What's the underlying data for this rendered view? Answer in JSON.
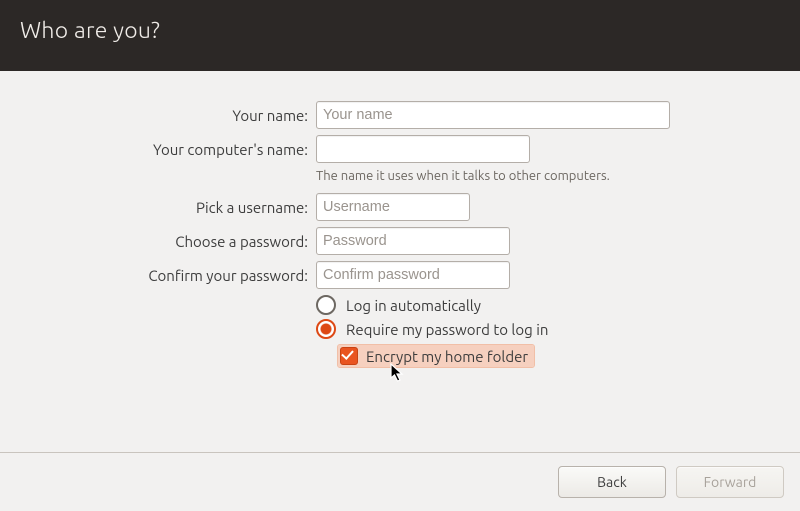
{
  "header": {
    "title": "Who are you?"
  },
  "form": {
    "name": {
      "label": "Your name:",
      "placeholder": "Your name",
      "value": ""
    },
    "computer": {
      "label": "Your computer's name:",
      "placeholder": "",
      "value": "",
      "hint": "The name it uses when it talks to other computers."
    },
    "username": {
      "label": "Pick a username:",
      "placeholder": "Username",
      "value": ""
    },
    "password": {
      "label": "Choose a password:",
      "placeholder": "Password",
      "value": ""
    },
    "confirm": {
      "label": "Confirm your password:",
      "placeholder": "Confirm password",
      "value": ""
    },
    "login_options": {
      "auto": {
        "label": "Log in automatically",
        "checked": false
      },
      "require": {
        "label": "Require my password to log in",
        "checked": true
      }
    },
    "encrypt": {
      "label": "Encrypt my home folder",
      "checked": true
    }
  },
  "footer": {
    "back": {
      "label": "Back",
      "enabled": true
    },
    "forward": {
      "label": "Forward",
      "enabled": false
    }
  }
}
